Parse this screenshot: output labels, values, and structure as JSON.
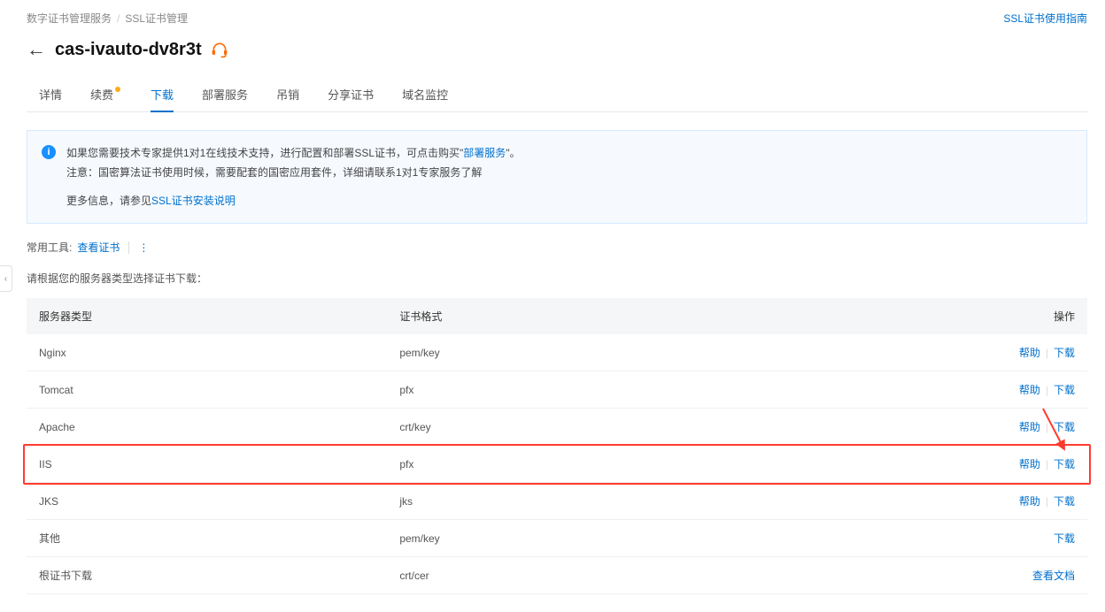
{
  "breadcrumb": {
    "root": "数字证书管理服务",
    "sep": "/",
    "current": "SSL证书管理"
  },
  "top_link": "SSL证书使用指南",
  "page_title": "cas-ivauto-dv8r3t",
  "tabs": [
    {
      "label": "详情"
    },
    {
      "label": "续费",
      "badge": true
    },
    {
      "label": "下载",
      "active": true
    },
    {
      "label": "部署服务"
    },
    {
      "label": "吊销"
    },
    {
      "label": "分享证书"
    },
    {
      "label": "域名监控"
    }
  ],
  "notice": {
    "line1a": "如果您需要技术专家提供1对1在线技术支持，进行配置和部署SSL证书，可点击购买\"",
    "line1_link": "部署服务",
    "line1b": "\"。",
    "line2": "注意：国密算法证书使用时候，需要配套的国密应用套件，详细请联系1对1专家服务了解",
    "line3a": "更多信息，请参见",
    "line3_link": "SSL证书安装说明"
  },
  "tools": {
    "label": "常用工具:",
    "view_cert": "查看证书"
  },
  "subtitle": "请根据您的服务器类型选择证书下载：",
  "columns": {
    "server": "服务器类型",
    "format": "证书格式",
    "actions": "操作"
  },
  "actions": {
    "help": "帮助",
    "download": "下载",
    "view_doc": "查看文档"
  },
  "rows": [
    {
      "server": "Nginx",
      "format": "pem/key",
      "help": true,
      "download": true
    },
    {
      "server": "Tomcat",
      "format": "pfx",
      "help": true,
      "download": true
    },
    {
      "server": "Apache",
      "format": "crt/key",
      "help": true,
      "download": true
    },
    {
      "server": "IIS",
      "format": "pfx",
      "help": true,
      "download": true,
      "highlight": true
    },
    {
      "server": "JKS",
      "format": "jks",
      "help": true,
      "download": true
    },
    {
      "server": "其他",
      "format": "pem/key",
      "help": false,
      "download": true
    },
    {
      "server": "根证书下载",
      "format": "crt/cer",
      "view_doc": true
    }
  ]
}
